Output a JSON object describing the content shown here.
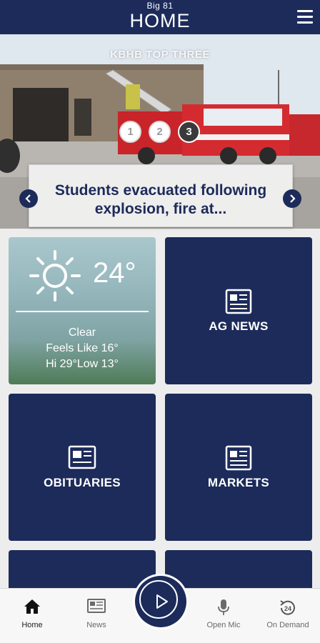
{
  "header": {
    "station": "Big 81",
    "title": "HOME"
  },
  "hero": {
    "label": "KBHB TOP THREE",
    "pages": [
      "1",
      "2",
      "3"
    ],
    "active_page": 3,
    "headline": "Students evacuated following explosion, fire at..."
  },
  "weather": {
    "temperature": "24°",
    "condition": "Clear",
    "feels_like": "Feels Like 16°",
    "hi_low": "Hi 29°Low 13°"
  },
  "tiles": {
    "ag_news": "AG NEWS",
    "obituaries": "OBITUARIES",
    "markets": "MARKETS"
  },
  "bottom_nav": {
    "home": "Home",
    "news": "News",
    "open_mic": "Open Mic",
    "on_demand": "On Demand",
    "on_demand_badge": "24"
  },
  "colors": {
    "brand": "#1c2b5a",
    "background": "#ededed"
  }
}
